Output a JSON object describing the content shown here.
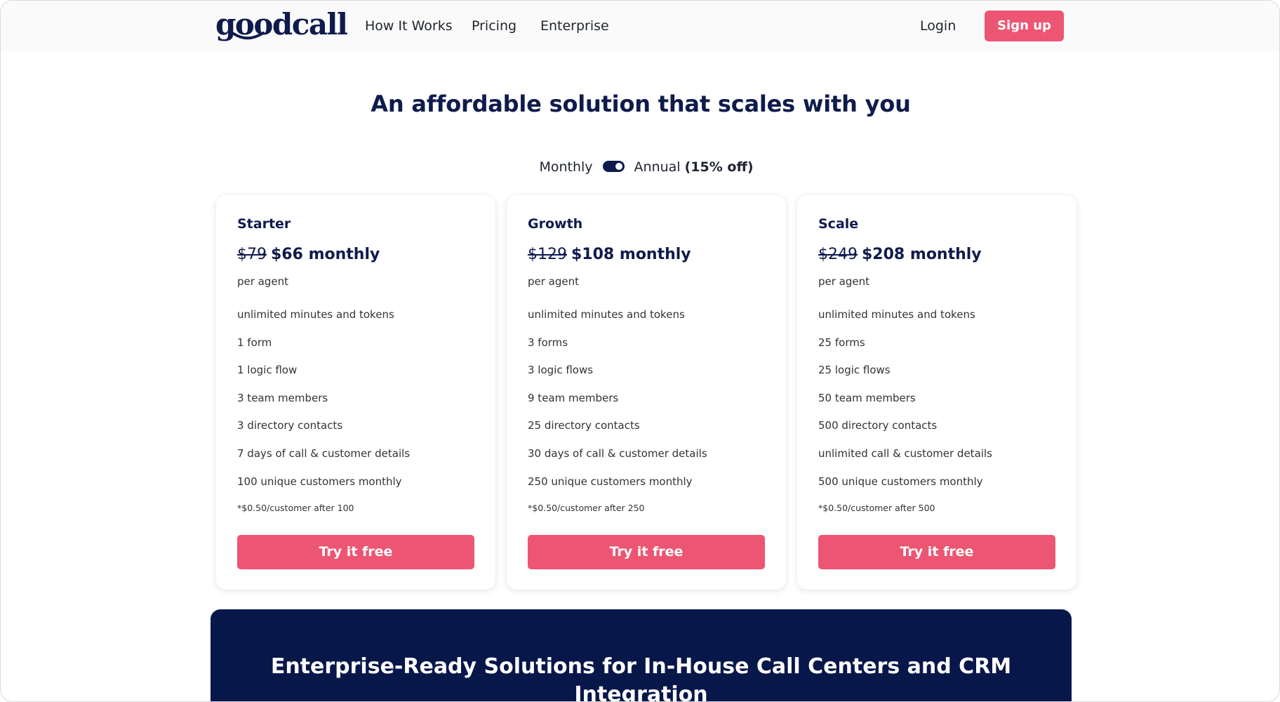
{
  "header": {
    "logo_text": "goodcall",
    "nav": [
      {
        "label": "How It Works"
      },
      {
        "label": "Pricing"
      },
      {
        "label": "Enterprise"
      }
    ],
    "login_label": "Login",
    "signup_label": "Sign up"
  },
  "hero": {
    "headline": "An affordable solution that scales with you",
    "toggle": {
      "monthly_label": "Monthly",
      "annual_label": "Annual",
      "annual_discount": "(15% off)",
      "selected": "Annual"
    }
  },
  "plans": [
    {
      "name": "Starter",
      "old_price": "$79",
      "price": "$66 monthly",
      "unit": "per agent",
      "features": [
        "unlimited minutes and tokens",
        "1 form",
        "1 logic flow",
        "3 team members",
        "3 directory contacts",
        "7 days of call & customer details",
        "100 unique customers monthly"
      ],
      "footnote": "*$0.50/customer after 100",
      "cta": "Try it free"
    },
    {
      "name": "Growth",
      "old_price": "$129",
      "price": "$108 monthly",
      "unit": "per agent",
      "features": [
        "unlimited minutes and tokens",
        "3 forms",
        "3 logic flows",
        "9 team members",
        "25 directory contacts",
        "30 days of call & customer details",
        "250 unique customers monthly"
      ],
      "footnote": "*$0.50/customer after 250",
      "cta": "Try it free"
    },
    {
      "name": "Scale",
      "old_price": "$249",
      "price": "$208 monthly",
      "unit": "per agent",
      "features": [
        "unlimited minutes and tokens",
        "25 forms",
        "25 logic flows",
        "50 team members",
        "500 directory contacts",
        "unlimited call & customer details",
        "500 unique customers monthly"
      ],
      "footnote": "*$0.50/customer after 500",
      "cta": "Try it free"
    }
  ],
  "enterprise": {
    "title": "Enterprise-Ready Solutions for In-House Call Centers and CRM Integration"
  },
  "colors": {
    "brand_navy": "#0f1b4c",
    "accent_pink": "#ec5673",
    "banner_navy": "#08174a"
  }
}
